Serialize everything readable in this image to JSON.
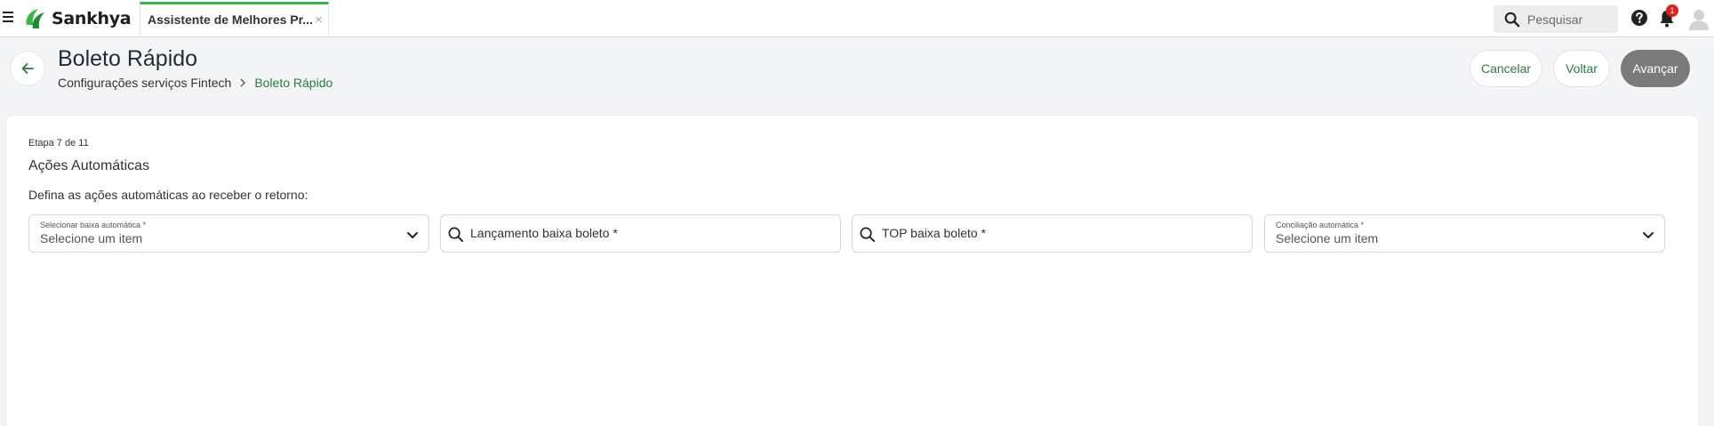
{
  "app": {
    "brand": "Sankhya",
    "brand_color": "#39b54a"
  },
  "tab": {
    "label": "Assistente de Melhores Pr...",
    "close": "×"
  },
  "search": {
    "placeholder": "Pesquisar"
  },
  "notifications": {
    "count": "1"
  },
  "page": {
    "title": "Boleto Rápido",
    "breadcrumb": [
      "Configurações serviços Fintech",
      "Boleto Rápido"
    ]
  },
  "actions": {
    "cancel": "Cancelar",
    "back": "Voltar",
    "next": "Avançar"
  },
  "wizard": {
    "step": "Etapa 7 de 11",
    "title": "Ações Automáticas",
    "description": "Defina as ações automáticas ao receber o retorno:"
  },
  "fields": {
    "baixa_automatica": {
      "label": "Selecionar baixa automática *",
      "value": "Selecione um item"
    },
    "lancamento_baixa": {
      "placeholder": "Lançamento baixa boleto *"
    },
    "top_baixa": {
      "placeholder": "TOP baixa boleto *"
    },
    "conciliacao": {
      "label": "Conciliação automática *",
      "value": "Selecione um item"
    }
  },
  "icons": [
    "hamburger-icon",
    "sankhya-logo",
    "search-icon",
    "help-icon",
    "bell-icon",
    "avatar-icon",
    "arrow-left-icon",
    "chevron-right-icon",
    "chevron-down-icon"
  ]
}
